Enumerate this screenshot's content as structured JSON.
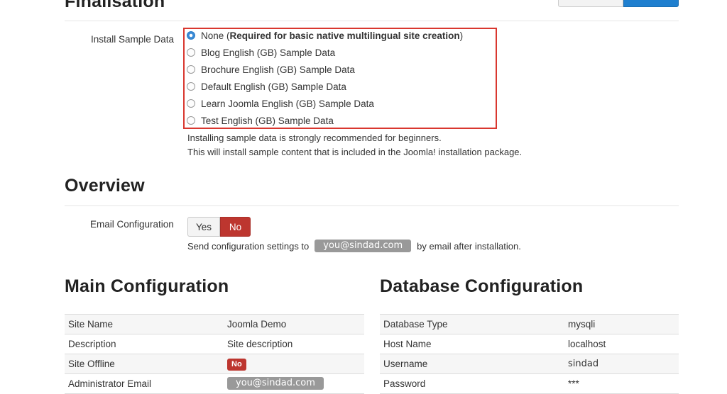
{
  "finalisation": {
    "heading": "Finalisation",
    "install_label": "Install Sample Data",
    "options": [
      {
        "prefix": "None (",
        "bold": "Required for basic native multilingual site creation",
        "suffix": ")",
        "checked": true
      },
      {
        "prefix": "Blog English (GB) Sample Data",
        "bold": "",
        "suffix": "",
        "checked": false
      },
      {
        "prefix": "Brochure English (GB) Sample Data",
        "bold": "",
        "suffix": "",
        "checked": false
      },
      {
        "prefix": "Default English (GB) Sample Data",
        "bold": "",
        "suffix": "",
        "checked": false
      },
      {
        "prefix": "Learn Joomla English (GB) Sample Data",
        "bold": "",
        "suffix": "",
        "checked": false
      },
      {
        "prefix": "Test English (GB) Sample Data",
        "bold": "",
        "suffix": "",
        "checked": false
      }
    ],
    "help_line1": "Installing sample data is strongly recommended for beginners.",
    "help_line2": "This will install sample content that is included in the Joomla! installation package."
  },
  "overview": {
    "heading": "Overview",
    "email_config_label": "Email Configuration",
    "yes_label": "Yes",
    "no_label": "No",
    "send_prefix": "Send configuration settings to",
    "send_email": "you@sindad.com",
    "send_suffix": "by email after installation."
  },
  "main_config": {
    "heading": "Main Configuration",
    "rows": [
      {
        "label": "Site Name",
        "value": "Joomla Demo"
      },
      {
        "label": "Description",
        "value": "Site description"
      },
      {
        "label": "Site Offline",
        "badge": "No"
      },
      {
        "label": "Administrator Email",
        "pill": "you@sindad.com"
      }
    ]
  },
  "db_config": {
    "heading": "Database Configuration",
    "rows": [
      {
        "label": "Database Type",
        "value": "mysqli"
      },
      {
        "label": "Host Name",
        "value": "localhost"
      },
      {
        "label": "Username",
        "value": "sindad"
      },
      {
        "label": "Password",
        "value": "***"
      }
    ]
  },
  "colors": {
    "highlight_border": "#d9372f",
    "danger": "#bd362f",
    "primary": "#1f7fcf",
    "pill": "#999999"
  }
}
